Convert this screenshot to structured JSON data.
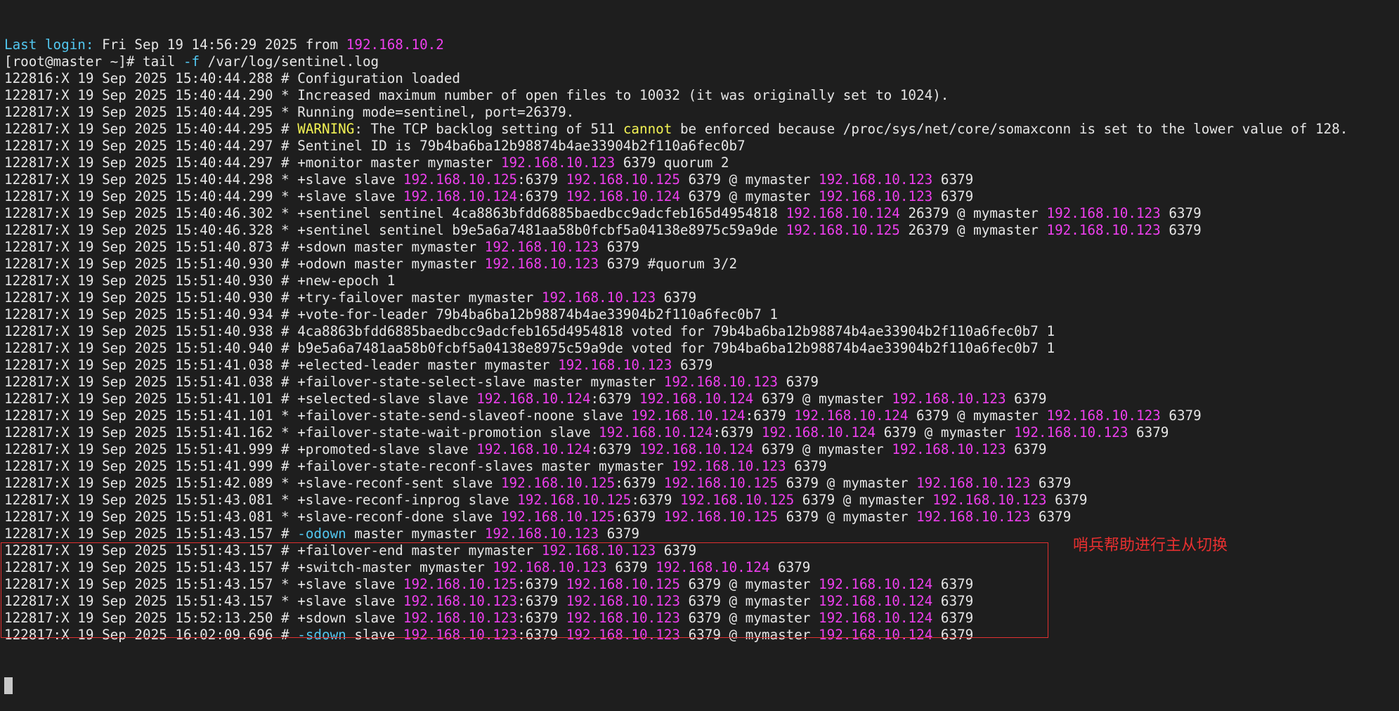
{
  "theme": {
    "background": "#1e1e1e",
    "text": "#e6e6e6",
    "ip": "#ee3fee",
    "keyword": "#52c7f0",
    "warning": "#f3f354",
    "annotation": "#e83030"
  },
  "terminal": {
    "lines": [
      [
        [
          "k",
          "Last login:"
        ],
        [
          "n",
          " Fri Sep 19 14:56:29 2025 from "
        ],
        [
          "i",
          "192.168.10.2"
        ]
      ],
      [
        [
          "n",
          "[root@master ~]# tail "
        ],
        [
          "k",
          "-f"
        ],
        [
          "n",
          " /var/log/sentinel.log"
        ]
      ],
      [
        [
          "n",
          "122816:X 19 Sep 2025 15:40:44.288 # Configuration loaded"
        ]
      ],
      [
        [
          "n",
          "122817:X 19 Sep 2025 15:40:44.290 * Increased maximum number of open files to 10032 (it was originally set to 1024)."
        ]
      ],
      [
        [
          "n",
          "122817:X 19 Sep 2025 15:40:44.295 * Running mode=sentinel, port=26379."
        ]
      ],
      [
        [
          "n",
          "122817:X 19 Sep 2025 15:40:44.295 # "
        ],
        [
          "y",
          "WARNING"
        ],
        [
          "n",
          ": The TCP backlog setting of 511 "
        ],
        [
          "y",
          "cannot"
        ],
        [
          "n",
          " be enforced because /proc/sys/net/core/somaxconn is set to the lower value of 128."
        ]
      ],
      [
        [
          "n",
          "122817:X 19 Sep 2025 15:40:44.297 # Sentinel ID is 79b4ba6ba12b98874b4ae33904b2f110a6fec0b7"
        ]
      ],
      [
        [
          "n",
          "122817:X 19 Sep 2025 15:40:44.297 # +monitor master mymaster "
        ],
        [
          "i",
          "192.168.10.123"
        ],
        [
          "n",
          " 6379 quorum 2"
        ]
      ],
      [
        [
          "n",
          "122817:X 19 Sep 2025 15:40:44.298 * +slave slave "
        ],
        [
          "i",
          "192.168.10.125"
        ],
        [
          "n",
          ":6379 "
        ],
        [
          "i",
          "192.168.10.125"
        ],
        [
          "n",
          " 6379 @ mymaster "
        ],
        [
          "i",
          "192.168.10.123"
        ],
        [
          "n",
          " 6379"
        ]
      ],
      [
        [
          "n",
          "122817:X 19 Sep 2025 15:40:44.299 * +slave slave "
        ],
        [
          "i",
          "192.168.10.124"
        ],
        [
          "n",
          ":6379 "
        ],
        [
          "i",
          "192.168.10.124"
        ],
        [
          "n",
          " 6379 @ mymaster "
        ],
        [
          "i",
          "192.168.10.123"
        ],
        [
          "n",
          " 6379"
        ]
      ],
      [
        [
          "n",
          "122817:X 19 Sep 2025 15:40:46.302 * +sentinel sentinel 4ca8863bfdd6885baedbcc9adcfeb165d4954818 "
        ],
        [
          "i",
          "192.168.10.124"
        ],
        [
          "n",
          " 26379 @ mymaster "
        ],
        [
          "i",
          "192.168.10.123"
        ],
        [
          "n",
          " 6379"
        ]
      ],
      [
        [
          "n",
          "122817:X 19 Sep 2025 15:40:46.328 * +sentinel sentinel b9e5a6a7481aa58b0fcbf5a04138e8975c59a9de "
        ],
        [
          "i",
          "192.168.10.125"
        ],
        [
          "n",
          " 26379 @ mymaster "
        ],
        [
          "i",
          "192.168.10.123"
        ],
        [
          "n",
          " 6379"
        ]
      ],
      [
        [
          "n",
          "122817:X 19 Sep 2025 15:51:40.873 # +sdown master mymaster "
        ],
        [
          "i",
          "192.168.10.123"
        ],
        [
          "n",
          " 6379"
        ]
      ],
      [
        [
          "n",
          "122817:X 19 Sep 2025 15:51:40.930 # +odown master mymaster "
        ],
        [
          "i",
          "192.168.10.123"
        ],
        [
          "n",
          " 6379 #quorum 3/2"
        ]
      ],
      [
        [
          "n",
          "122817:X 19 Sep 2025 15:51:40.930 # +new-epoch 1"
        ]
      ],
      [
        [
          "n",
          "122817:X 19 Sep 2025 15:51:40.930 # +try-failover master mymaster "
        ],
        [
          "i",
          "192.168.10.123"
        ],
        [
          "n",
          " 6379"
        ]
      ],
      [
        [
          "n",
          "122817:X 19 Sep 2025 15:51:40.934 # +vote-for-leader 79b4ba6ba12b98874b4ae33904b2f110a6fec0b7 1"
        ]
      ],
      [
        [
          "n",
          "122817:X 19 Sep 2025 15:51:40.938 # 4ca8863bfdd6885baedbcc9adcfeb165d4954818 voted for 79b4ba6ba12b98874b4ae33904b2f110a6fec0b7 1"
        ]
      ],
      [
        [
          "n",
          "122817:X 19 Sep 2025 15:51:40.940 # b9e5a6a7481aa58b0fcbf5a04138e8975c59a9de voted for 79b4ba6ba12b98874b4ae33904b2f110a6fec0b7 1"
        ]
      ],
      [
        [
          "n",
          "122817:X 19 Sep 2025 15:51:41.038 # +elected-leader master mymaster "
        ],
        [
          "i",
          "192.168.10.123"
        ],
        [
          "n",
          " 6379"
        ]
      ],
      [
        [
          "n",
          "122817:X 19 Sep 2025 15:51:41.038 # +failover-state-select-slave master mymaster "
        ],
        [
          "i",
          "192.168.10.123"
        ],
        [
          "n",
          " 6379"
        ]
      ],
      [
        [
          "n",
          "122817:X 19 Sep 2025 15:51:41.101 # +selected-slave slave "
        ],
        [
          "i",
          "192.168.10.124"
        ],
        [
          "n",
          ":6379 "
        ],
        [
          "i",
          "192.168.10.124"
        ],
        [
          "n",
          " 6379 @ mymaster "
        ],
        [
          "i",
          "192.168.10.123"
        ],
        [
          "n",
          " 6379"
        ]
      ],
      [
        [
          "n",
          "122817:X 19 Sep 2025 15:51:41.101 * +failover-state-send-slaveof-noone slave "
        ],
        [
          "i",
          "192.168.10.124"
        ],
        [
          "n",
          ":6379 "
        ],
        [
          "i",
          "192.168.10.124"
        ],
        [
          "n",
          " 6379 @ mymaster "
        ],
        [
          "i",
          "192.168.10.123"
        ],
        [
          "n",
          " 6379"
        ]
      ],
      [
        [
          "n",
          "122817:X 19 Sep 2025 15:51:41.162 * +failover-state-wait-promotion slave "
        ],
        [
          "i",
          "192.168.10.124"
        ],
        [
          "n",
          ":6379 "
        ],
        [
          "i",
          "192.168.10.124"
        ],
        [
          "n",
          " 6379 @ mymaster "
        ],
        [
          "i",
          "192.168.10.123"
        ],
        [
          "n",
          " 6379"
        ]
      ],
      [
        [
          "n",
          "122817:X 19 Sep 2025 15:51:41.999 # +promoted-slave slave "
        ],
        [
          "i",
          "192.168.10.124"
        ],
        [
          "n",
          ":6379 "
        ],
        [
          "i",
          "192.168.10.124"
        ],
        [
          "n",
          " 6379 @ mymaster "
        ],
        [
          "i",
          "192.168.10.123"
        ],
        [
          "n",
          " 6379"
        ]
      ],
      [
        [
          "n",
          "122817:X 19 Sep 2025 15:51:41.999 # +failover-state-reconf-slaves master mymaster "
        ],
        [
          "i",
          "192.168.10.123"
        ],
        [
          "n",
          " 6379"
        ]
      ],
      [
        [
          "n",
          "122817:X 19 Sep 2025 15:51:42.089 * +slave-reconf-sent slave "
        ],
        [
          "i",
          "192.168.10.125"
        ],
        [
          "n",
          ":6379 "
        ],
        [
          "i",
          "192.168.10.125"
        ],
        [
          "n",
          " 6379 @ mymaster "
        ],
        [
          "i",
          "192.168.10.123"
        ],
        [
          "n",
          " 6379"
        ]
      ],
      [
        [
          "n",
          "122817:X 19 Sep 2025 15:51:43.081 * +slave-reconf-inprog slave "
        ],
        [
          "i",
          "192.168.10.125"
        ],
        [
          "n",
          ":6379 "
        ],
        [
          "i",
          "192.168.10.125"
        ],
        [
          "n",
          " 6379 @ mymaster "
        ],
        [
          "i",
          "192.168.10.123"
        ],
        [
          "n",
          " 6379"
        ]
      ],
      [
        [
          "n",
          "122817:X 19 Sep 2025 15:51:43.081 * +slave-reconf-done slave "
        ],
        [
          "i",
          "192.168.10.125"
        ],
        [
          "n",
          ":6379 "
        ],
        [
          "i",
          "192.168.10.125"
        ],
        [
          "n",
          " 6379 @ mymaster "
        ],
        [
          "i",
          "192.168.10.123"
        ],
        [
          "n",
          " 6379"
        ]
      ],
      [
        [
          "n",
          "122817:X 19 Sep 2025 15:51:43.157 # "
        ],
        [
          "k",
          "-odown"
        ],
        [
          "n",
          " master mymaster "
        ],
        [
          "i",
          "192.168.10.123"
        ],
        [
          "n",
          " 6379"
        ]
      ],
      [
        [
          "n",
          "122817:X 19 Sep 2025 15:51:43.157 # +failover-end master mymaster "
        ],
        [
          "i",
          "192.168.10.123"
        ],
        [
          "n",
          " 6379"
        ]
      ],
      [
        [
          "n",
          "122817:X 19 Sep 2025 15:51:43.157 # +switch-master mymaster "
        ],
        [
          "i",
          "192.168.10.123"
        ],
        [
          "n",
          " 6379 "
        ],
        [
          "i",
          "192.168.10.124"
        ],
        [
          "n",
          " 6379"
        ]
      ],
      [
        [
          "n",
          "122817:X 19 Sep 2025 15:51:43.157 * +slave slave "
        ],
        [
          "i",
          "192.168.10.125"
        ],
        [
          "n",
          ":6379 "
        ],
        [
          "i",
          "192.168.10.125"
        ],
        [
          "n",
          " 6379 @ mymaster "
        ],
        [
          "i",
          "192.168.10.124"
        ],
        [
          "n",
          " 6379"
        ]
      ],
      [
        [
          "n",
          "122817:X 19 Sep 2025 15:51:43.157 * +slave slave "
        ],
        [
          "i",
          "192.168.10.123"
        ],
        [
          "n",
          ":6379 "
        ],
        [
          "i",
          "192.168.10.123"
        ],
        [
          "n",
          " 6379 @ mymaster "
        ],
        [
          "i",
          "192.168.10.124"
        ],
        [
          "n",
          " 6379"
        ]
      ],
      [
        [
          "n",
          "122817:X 19 Sep 2025 15:52:13.250 # +sdown slave "
        ],
        [
          "i",
          "192.168.10.123"
        ],
        [
          "n",
          ":6379 "
        ],
        [
          "i",
          "192.168.10.123"
        ],
        [
          "n",
          " 6379 @ mymaster "
        ],
        [
          "i",
          "192.168.10.124"
        ],
        [
          "n",
          " 6379"
        ]
      ],
      [
        [
          "n",
          "122817:X 19 Sep 2025 16:02:09.696 # "
        ],
        [
          "k",
          "-sdown"
        ],
        [
          "n",
          " slave "
        ],
        [
          "i",
          "192.168.10.123"
        ],
        [
          "n",
          ":6379 "
        ],
        [
          "i",
          "192.168.10.123"
        ],
        [
          "n",
          " 6379 @ mymaster "
        ],
        [
          "i",
          "192.168.10.124"
        ],
        [
          "n",
          " 6379"
        ]
      ]
    ]
  },
  "annotation": {
    "text": "哨兵帮助进行主从切换"
  }
}
